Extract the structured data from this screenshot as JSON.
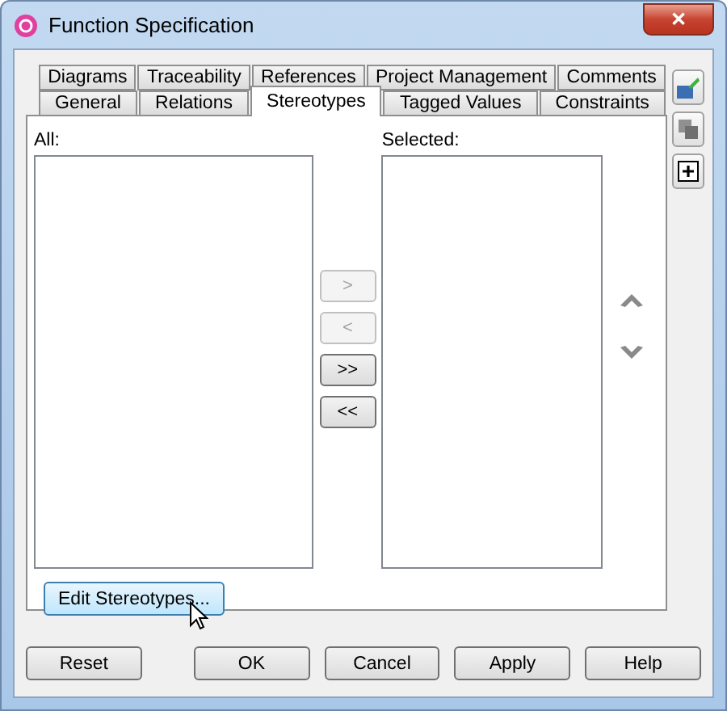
{
  "window": {
    "title": "Function Specification",
    "close": "✕"
  },
  "tab_rows": [
    [
      {
        "label": "Diagrams",
        "selected": false
      },
      {
        "label": "Traceability",
        "selected": false
      },
      {
        "label": "References",
        "selected": false
      },
      {
        "label": "Project Management",
        "selected": false
      },
      {
        "label": "Comments",
        "selected": false
      }
    ],
    [
      {
        "label": "General",
        "selected": false
      },
      {
        "label": "Relations",
        "selected": false
      },
      {
        "label": "Stereotypes",
        "selected": true
      },
      {
        "label": "Tagged Values",
        "selected": false
      },
      {
        "label": "Constraints",
        "selected": false
      }
    ]
  ],
  "all_list": {
    "label": "All:"
  },
  "selected_list": {
    "label": "Selected:"
  },
  "transfer_buttons": [
    {
      "label": ">",
      "disabled": true
    },
    {
      "label": "<",
      "disabled": true
    },
    {
      "label": ">>",
      "disabled": false
    },
    {
      "label": "<<",
      "disabled": false
    }
  ],
  "edit_button": {
    "label": "Edit Stereotypes...",
    "hovered": true
  },
  "footer_buttons": [
    {
      "label": "Reset"
    },
    {
      "label": "OK"
    },
    {
      "label": "Cancel"
    },
    {
      "label": "Apply"
    },
    {
      "label": "Help"
    }
  ]
}
